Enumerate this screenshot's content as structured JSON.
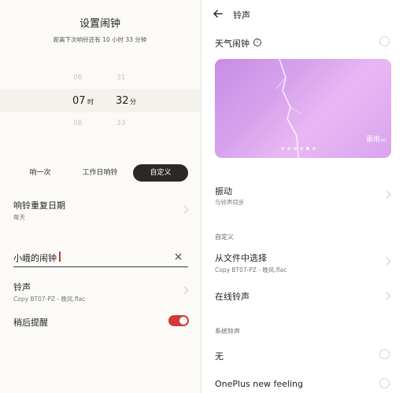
{
  "left": {
    "title": "设置闹钟",
    "next_ring": "距离下次响铃还有  10 小时 33 分钟",
    "picker": {
      "hours": [
        "06",
        "07",
        "08"
      ],
      "minutes": [
        "31",
        "32",
        "33"
      ],
      "hour_unit": "时",
      "minute_unit": "分"
    },
    "repeat_tabs": [
      "响一次",
      "工作日响铃",
      "自定义"
    ],
    "repeat": {
      "title": "响铃重复日期",
      "value": "每天"
    },
    "name_input": {
      "value": "小峨的闹钟"
    },
    "ringtone": {
      "title": "铃声",
      "value": "Copy BT07-PZ - 晚风.flac"
    },
    "snooze": {
      "title": "稍后提醒",
      "enabled": true
    }
  },
  "right": {
    "header": {
      "title": "铃声"
    },
    "weather": {
      "title": "天气闹钟",
      "card_label": "雷雨",
      "card_tag": "on"
    },
    "vibration": {
      "title": "振动",
      "subtitle": "与铃声同步"
    },
    "custom_section": "自定义",
    "from_file": {
      "title": "从文件中选择",
      "subtitle": "Copy BT07-PZ - 晚风.flac"
    },
    "online": {
      "title": "在线铃声"
    },
    "system_section": "系统铃声",
    "system_items": [
      "无",
      "OnePlus new feeling"
    ]
  },
  "colors": {
    "accent": "#d33a35",
    "dark_pill": "#2c2823",
    "card_purple": "#d7a2ec"
  },
  "icons": [
    "back-arrow-icon",
    "info-icon",
    "chevron-right-icon",
    "clear-icon",
    "lightning-icon"
  ]
}
